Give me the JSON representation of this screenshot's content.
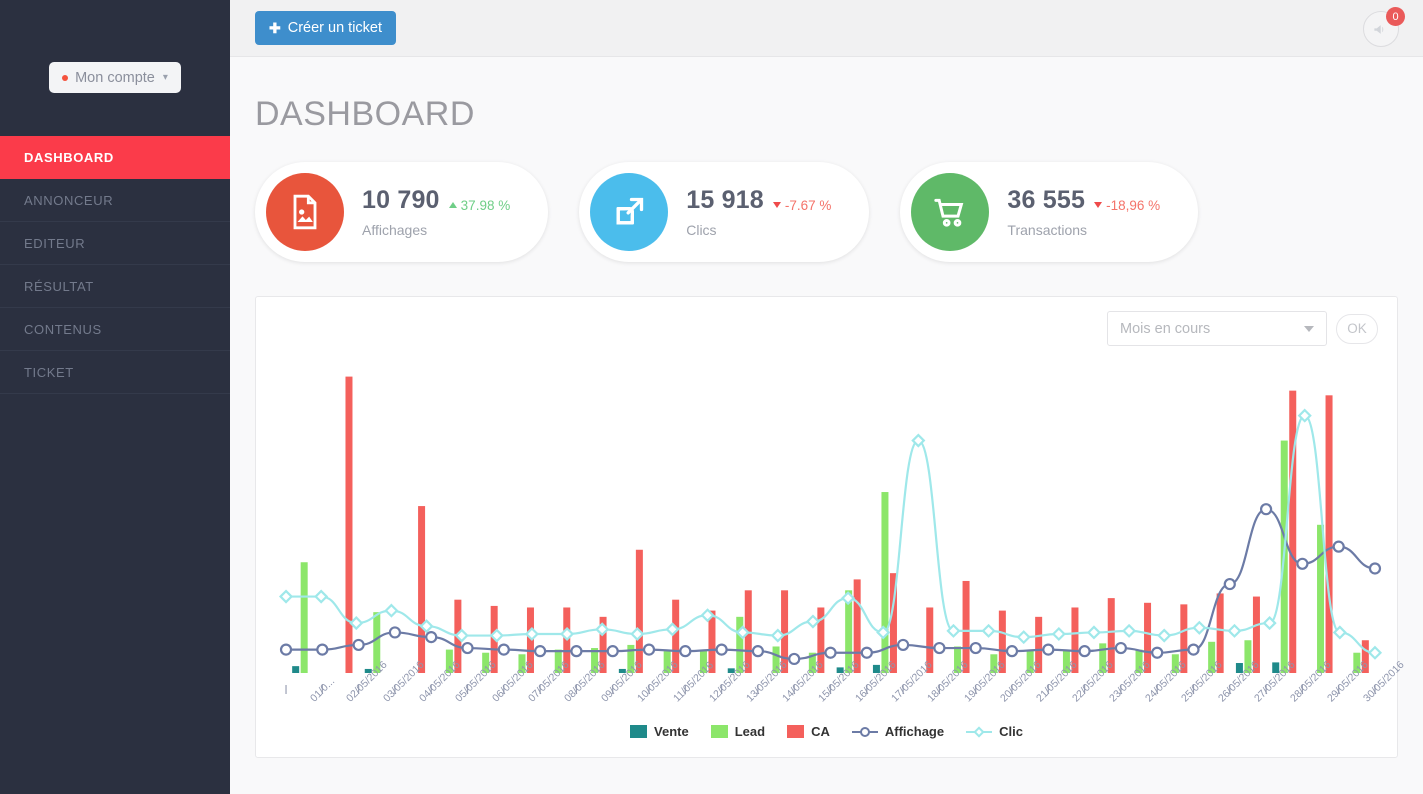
{
  "sidebar": {
    "account_button": {
      "label": "Mon compte",
      "chevron_icon": "chevron-down-icon",
      "dot_color": "#f4523d"
    },
    "items": [
      {
        "label": "DASHBOARD",
        "active": true
      },
      {
        "label": "ANNONCEUR",
        "active": false
      },
      {
        "label": "EDITEUR",
        "active": false
      },
      {
        "label": "RÉSULTAT",
        "active": false
      },
      {
        "label": "CONTENUS",
        "active": false
      },
      {
        "label": "TICKET",
        "active": false
      }
    ],
    "bg_color": "#2b3040",
    "active_color": "#fb3b4a"
  },
  "topbar": {
    "create_ticket_label": "Créer un ticket",
    "create_ticket_icon": "plus-icon",
    "notification_icon": "megaphone-icon",
    "notification_count": "0"
  },
  "page": {
    "title": "DASHBOARD"
  },
  "stat_cards": [
    {
      "value": "10 790",
      "delta": "37.98 %",
      "delta_direction": "up",
      "label": "Affichages",
      "icon": "image-file-icon",
      "icon_color": "#e8553c"
    },
    {
      "value": "15 918",
      "delta": "-7.67 %",
      "delta_direction": "down",
      "label": "Clics",
      "icon": "external-link-icon",
      "icon_color": "#4bbdec"
    },
    {
      "value": "36 555",
      "delta": "-18,96 %",
      "delta_direction": "down",
      "label": "Transactions",
      "icon": "shopping-cart-icon",
      "icon_color": "#5fb968"
    }
  ],
  "chart_panel": {
    "period_select": {
      "value": "Mois en cours",
      "caret_icon": "caret-down-icon"
    },
    "ok_button": "OK"
  },
  "chart_data": {
    "type": "bar",
    "title": "",
    "xlabel": "",
    "ylabel": "",
    "grid": false,
    "legend_position": "bottom",
    "ylim": [
      0,
      100
    ],
    "categories": [
      "01/0...",
      "02/05/2016",
      "03/05/2016",
      "04/05/2016",
      "05/05/2016",
      "06/05/2016",
      "07/05/2016",
      "08/05/2016",
      "09/05/2016",
      "10/05/2016",
      "11/05/2016",
      "12/05/2016",
      "13/05/2016",
      "14/05/2016",
      "15/05/2016",
      "16/05/2016",
      "17/05/2016",
      "18/05/2016",
      "19/05/2016",
      "20/05/2016",
      "21/05/2016",
      "22/05/2016",
      "23/05/2016",
      "24/05/2016",
      "25/05/2016",
      "26/05/2016",
      "27/05/2016",
      "28/05/2016",
      "29/05/2016",
      "30/05/2016"
    ],
    "series": [
      {
        "name": "Vente",
        "type": "bar",
        "color": "#1f8a8a",
        "values": [
          2.2,
          0,
          1.3,
          0,
          0,
          0,
          0,
          0,
          0,
          1.3,
          0,
          0,
          1.5,
          0,
          0,
          1.8,
          2.6,
          0,
          0,
          0,
          0,
          0,
          0,
          0,
          0,
          0,
          3.2,
          3.4,
          0,
          0
        ]
      },
      {
        "name": "Lead",
        "type": "bar",
        "color": "#8ce66a",
        "values": [
          35.5,
          0,
          19.5,
          0,
          7.5,
          6.5,
          6.0,
          7.5,
          8.0,
          9.0,
          7.0,
          7.5,
          18.0,
          8.5,
          6.5,
          26.5,
          58.0,
          0,
          8.5,
          6.0,
          7.5,
          7.5,
          9.5,
          7.5,
          6.0,
          10.0,
          10.5,
          74.5,
          47.5,
          6.5
        ]
      },
      {
        "name": "CA",
        "type": "bar",
        "color": "#f4605c",
        "values": [
          0,
          95.0,
          0,
          53.5,
          23.5,
          21.5,
          21.0,
          21.0,
          18.0,
          39.5,
          23.5,
          20.0,
          26.5,
          26.5,
          21.0,
          30.0,
          32.0,
          21.0,
          29.5,
          20.0,
          18.0,
          21.0,
          24.0,
          22.5,
          22.0,
          25.5,
          24.5,
          90.5,
          89.0,
          10.5
        ]
      },
      {
        "name": "Affichage",
        "type": "line",
        "color": "#6c7ba6",
        "marker": "circle",
        "values": [
          7.5,
          7.5,
          9.0,
          13.0,
          11.5,
          8.0,
          7.5,
          7.0,
          7.0,
          7.0,
          7.5,
          7.0,
          7.5,
          7.0,
          4.5,
          6.5,
          6.5,
          9.0,
          8.0,
          8.0,
          7.0,
          7.5,
          7.0,
          8.0,
          6.5,
          7.5,
          28.5,
          52.5,
          35.0,
          40.5,
          33.5
        ]
      },
      {
        "name": "Clic",
        "type": "line",
        "color": "#9fe8ea",
        "marker": "diamond",
        "values": [
          24.5,
          24.5,
          16.0,
          20.0,
          15.0,
          12.0,
          12.0,
          12.5,
          12.5,
          14.0,
          12.5,
          14.0,
          18.5,
          13.0,
          12.0,
          16.5,
          24.0,
          13.0,
          74.5,
          13.5,
          13.5,
          11.5,
          12.5,
          13.0,
          13.5,
          12.0,
          14.5,
          13.5,
          16.0,
          82.5,
          13.0,
          6.5
        ]
      }
    ],
    "legend": [
      {
        "label": "Vente",
        "color": "#1f8a8a",
        "kind": "box"
      },
      {
        "label": "Lead",
        "color": "#8ce66a",
        "kind": "box"
      },
      {
        "label": "CA",
        "color": "#f4605c",
        "kind": "box"
      },
      {
        "label": "Affichage",
        "color": "#6c7ba6",
        "kind": "line-circle"
      },
      {
        "label": "Clic",
        "color": "#9fe8ea",
        "kind": "line-diamond"
      }
    ]
  }
}
